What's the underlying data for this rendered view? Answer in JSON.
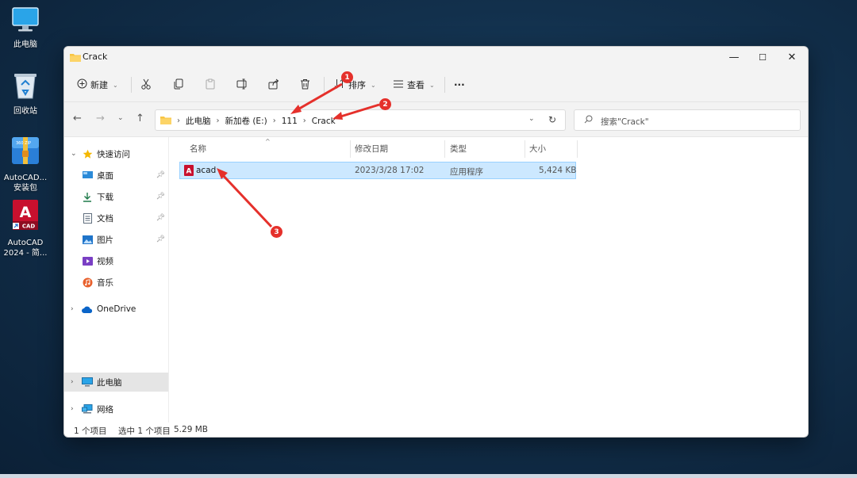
{
  "desktop": {
    "icons": [
      {
        "label": "此电脑",
        "icon": "monitor-icon"
      },
      {
        "label": "回收站",
        "icon": "recycle-bin-icon"
      },
      {
        "label_line1": "AutoCAD...",
        "label_line2": "安装包",
        "icon": "zip-archive-icon",
        "badge": "360 ZIP"
      },
      {
        "label_line1": "AutoCAD",
        "label_line2": "2024 - 简...",
        "icon": "autocad-app-icon",
        "glyph": "A",
        "tag": "CAD"
      }
    ]
  },
  "window": {
    "title": "Crack",
    "controls": {
      "minimize": "—",
      "maximize": "☐",
      "close": "✕"
    }
  },
  "toolbar": {
    "new_label": "新建",
    "sort_label": "排序",
    "view_label": "查看",
    "more_label": "···"
  },
  "address": {
    "crumbs": [
      "此电脑",
      "新加卷 (E:)",
      "111",
      "Crack"
    ],
    "search_placeholder": "搜索\"Crack\""
  },
  "sidebar": {
    "items": [
      {
        "label": "快速访问",
        "icon": "star-icon",
        "expand": "expanded"
      },
      {
        "label": "桌面",
        "icon": "desktop-icon",
        "pinned": true
      },
      {
        "label": "下载",
        "icon": "download-icon",
        "pinned": true
      },
      {
        "label": "文档",
        "icon": "document-icon",
        "pinned": true
      },
      {
        "label": "图片",
        "icon": "picture-icon",
        "pinned": true
      },
      {
        "label": "视频",
        "icon": "video-icon"
      },
      {
        "label": "音乐",
        "icon": "music-icon"
      },
      {
        "label": "OneDrive",
        "icon": "cloud-icon",
        "expand": "collapsed"
      },
      {
        "label": "此电脑",
        "icon": "monitor-icon",
        "expand": "collapsed",
        "selected": true
      },
      {
        "label": "网络",
        "icon": "network-icon",
        "expand": "collapsed"
      }
    ]
  },
  "columns": {
    "name": "名称",
    "modified": "修改日期",
    "type": "类型",
    "size": "大小"
  },
  "files": [
    {
      "name": "acad",
      "modified": "2023/3/28 17:02",
      "type": "应用程序",
      "size": "5,424 KB",
      "icon": "autocad-app-icon",
      "selected": true
    }
  ],
  "status": {
    "count": "1 个项目",
    "selection": "选中 1 个项目",
    "size": "5.29 MB"
  },
  "annotations": {
    "markers": [
      "1",
      "2",
      "3"
    ],
    "color": "#e5302b"
  },
  "colors": {
    "accent": "#0067c0",
    "selection_bg": "#cce8ff",
    "folder": "#f8c543",
    "autocad_red": "#c8102e"
  }
}
